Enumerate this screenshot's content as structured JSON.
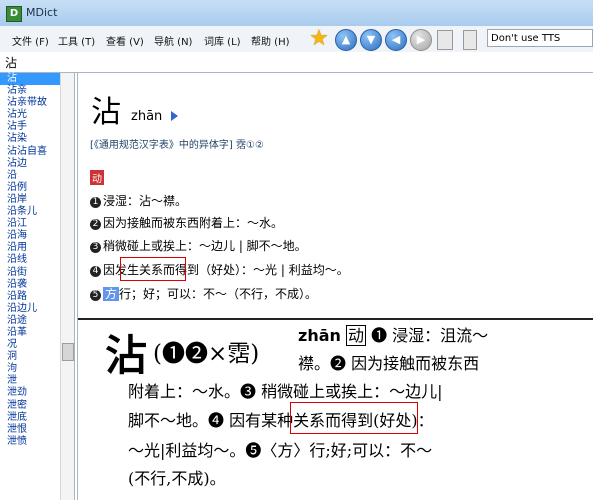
{
  "window": {
    "title": "MDict"
  },
  "menu": [
    "文件 (F)",
    "工具 (T)",
    "查看 (V)",
    "导航 (N)",
    "词库 (L)",
    "帮助 (H)"
  ],
  "toolbar": {
    "tts_value": "Don't use TTS"
  },
  "search": {
    "value": "沾"
  },
  "sidebar": {
    "items": [
      "沾",
      "沾亲",
      "沾亲带故",
      "沾光",
      "沾手",
      "沾染",
      "沾沾自喜",
      "沾边",
      "沿",
      "沿例",
      "沿岸",
      "沿条儿",
      "沿江",
      "沿海",
      "沿用",
      "沿线",
      "沿街",
      "沿袭",
      "沿路",
      "沿边儿",
      "沿途",
      "沿革",
      "况",
      "泂",
      "泃",
      "泄",
      "泄劲",
      "泄密",
      "泄底",
      "泄恨",
      "泄愤"
    ],
    "selected_index": 0
  },
  "entry": {
    "headword": "沾",
    "pinyin": "zhān",
    "variant_note": "[《通用规范汉字表》中的异体字] 霑①②",
    "pos": "动",
    "def1_num": "1",
    "def1_text": "浸湿：沾～襟。",
    "def2_num": "2",
    "def2_text": "因为接触而被东西附着上：～水。",
    "def3_num": "3",
    "def3_text": "稍微碰上或挨上：～边儿 | 脚不～地。",
    "def4_num": "4",
    "def4_pre": "因",
    "def4_hl": "发生关系",
    "def4_post": "而得到（好处）：～光 | 利益均～。",
    "def5_num": "5",
    "def5_pos": "方",
    "def5_text": "行；好；可以：不～（不行，不成）。"
  },
  "scan": {
    "char": "沾",
    "paren": "(❶❷×霑)",
    "pinyin": "zhān",
    "pos": "动",
    "l1": "❶ 浸湿：沮流～",
    "l2": "襟。❷ 因为接触而被东西",
    "l3": "附着上：～水。❸ 稍微碰上或挨上：～边儿|",
    "l4_pre": "脚不～地。❹ 因",
    "l4_hl": "有某种关系",
    "l4_post": "而得到(好处)：",
    "l5": "～光|利益均～。❺〈方〉行;好;可以：不～",
    "l6": "(不行,不成)。"
  }
}
